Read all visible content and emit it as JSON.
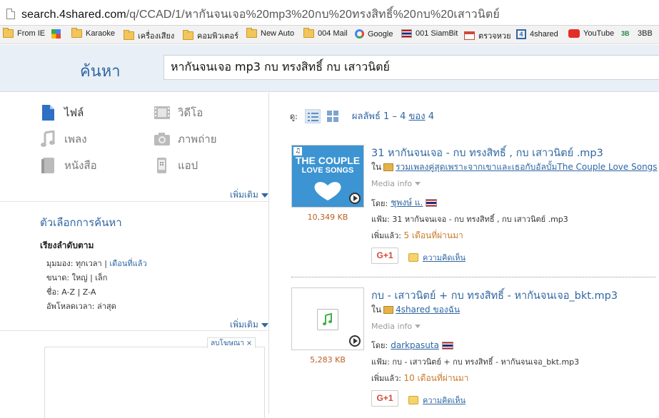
{
  "browser": {
    "url_host": "search.4shared.com",
    "url_path": "/q/CCAD/1/หากันจนเจอ%20mp3%20กบ%20ทรงสิทธิ์%20กบ%20เสาวนิตย์"
  },
  "bookmarks": [
    {
      "label": "From IE",
      "icon": "folder-icon"
    },
    {
      "label": "",
      "icon": "apps-icon"
    },
    {
      "label": "Karaoke",
      "icon": "folder-icon"
    },
    {
      "label": "เครื่องเสียง",
      "icon": "folder-icon"
    },
    {
      "label": "คอมพิวเตอร์",
      "icon": "folder-icon"
    },
    {
      "label": "New Auto",
      "icon": "folder-icon"
    },
    {
      "label": "004 Mail",
      "icon": "folder-icon"
    },
    {
      "label": "Google",
      "icon": "google-icon"
    },
    {
      "label": "001 SiamBit",
      "icon": "thai-flag-icon"
    },
    {
      "label": "ตรวจหวย",
      "icon": "gmail-icon"
    },
    {
      "label": "4shared",
      "icon": "4shared-icon"
    },
    {
      "label": "YouTube",
      "icon": "youtube-icon"
    },
    {
      "label": "3BB",
      "icon": "3bb-icon"
    }
  ],
  "header": {
    "title": "ค้นหา",
    "search_value": "หากันจนเจอ mp3 กบ ทรงสิทธิ์ กบ เสาวนิตย์"
  },
  "categories": [
    {
      "label": "ไฟล์",
      "icon": "file-icon"
    },
    {
      "label": "วิดีโอ",
      "icon": "video-icon"
    },
    {
      "label": "เพลง",
      "icon": "music-icon"
    },
    {
      "label": "ภาพถ่าย",
      "icon": "camera-icon"
    },
    {
      "label": "หนังสือ",
      "icon": "book-icon"
    },
    {
      "label": "แอป",
      "icon": "app-icon"
    }
  ],
  "more_label": "เพิ่มเติม",
  "options": {
    "title": "ตัวเลือกการค้นหา",
    "sort_title": "เรียงลำดับตาม",
    "views_label": "มุมมอง:",
    "views_value": "ทุกเวลา",
    "views_link": "เดือนที่แล้ว",
    "size_label": "ขนาด:",
    "size_value": "ใหญ่ | เล็ก",
    "name_label": "ชื่อ:",
    "name_value": "A-Z | Z-A",
    "upload_label": "อัพโหลดเวลา:",
    "upload_value": "ล่าสุด",
    "ad_label": "ลบโฆษณา ×"
  },
  "results_bar": {
    "prefix": "ดู:",
    "count_text": "ผลลัพธ์ 1 – 4",
    "of": "ของ",
    "total": "4"
  },
  "results": [
    {
      "title": "31 หากันจนเจอ - กบ ทรงสิทธิ์ , กบ เสาวนิตย์ .mp3",
      "in_label": "ใน",
      "folder": "รวมเพลงคู่สุดเพราะจากเขาและเธอกับอัลบั้มThe Couple Love Songs",
      "media_info": "Media info",
      "by_label": "โดย:",
      "uploader": "ชุพงษ์ แ.",
      "file_label": "แฟ้ม:",
      "file_name": "31 หากันจนเจอ - กบ ทรงสิทธิ์ , กบ เสาวนิตย์ .mp3",
      "added_label": "เพิ่มแล้ว:",
      "added_value": "5 เดือนที่ผ่านมา",
      "size": "10,349 KB",
      "gplus": "G+1",
      "comment": "ความคิดเห็น",
      "album_line1": "THE COUPLE",
      "album_line2": "LOVE SONGS"
    },
    {
      "title": "กบ - เสาวนิตย์ + กบ ทรงสิทธิ์ - หากันจนเจอ_bkt.mp3",
      "in_label": "ใน",
      "folder": "4shared ของฉัน",
      "media_info": "Media info",
      "by_label": "โดย:",
      "uploader": "darkpasuta",
      "file_label": "แฟ้ม:",
      "file_name": "กบ - เสาวนิตย์ + กบ ทรงสิทธิ์ - หากันจนเจอ_bkt.mp3",
      "added_label": "เพิ่มแล้ว:",
      "added_value": "10 เดือนที่ผ่านมา",
      "size": "5,283 KB",
      "gplus": "G+1",
      "comment": "ความคิดเห็น"
    }
  ]
}
